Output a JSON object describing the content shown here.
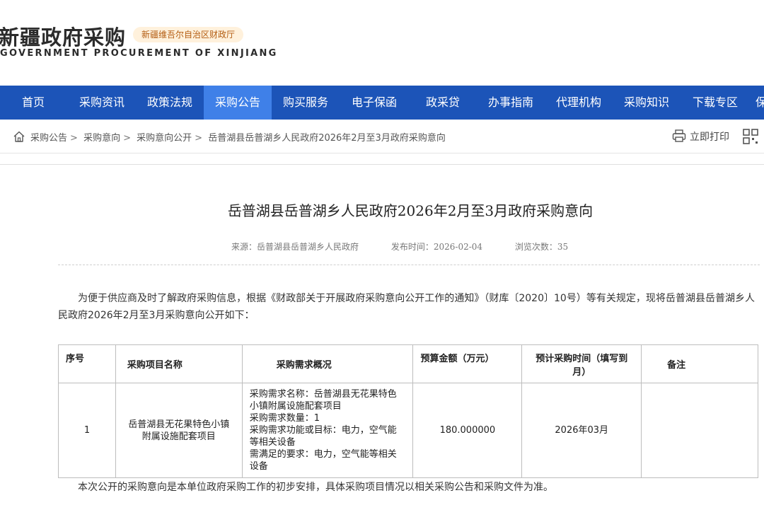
{
  "header": {
    "logo_cn": "新疆政府采购",
    "logo_badge": "新疆维吾尔自治区财政厅",
    "logo_en": "GOVERNMENT PROCUREMENT OF XINJIANG"
  },
  "nav": {
    "items": [
      "首页",
      "采购资讯",
      "政策法规",
      "采购公告",
      "购买服务",
      "电子保函",
      "政采贷",
      "办事指南",
      "代理机构",
      "采购知识",
      "下载专区",
      "保"
    ],
    "active": "采购公告"
  },
  "breadcrumb": {
    "items": [
      "采购公告",
      "采购意向",
      "采购意向公开"
    ],
    "current": "岳普湖县岳普湖乡人民政府2026年2月至3月政府采购意向",
    "separator": ">",
    "print_label": "立即打印"
  },
  "article": {
    "title": "岳普湖县岳普湖乡人民政府2026年2月至3月政府采购意向",
    "source": "来源：岳普湖县岳普湖乡人民政府",
    "publish_time": "发布时间：2026-02-04",
    "views": "浏览次数：35",
    "intro": "为便于供应商及时了解政府采购信息，根据《财政部关于开展政府采购意向公开工作的通知》（财库〔2020〕10号）等有关规定，现将岳普湖县岳普湖乡人民政府2026年2月至3月采购意向公开如下：",
    "table": {
      "headers": [
        "序号",
        "采购项目名称",
        "采购需求概况",
        "预算金额（万元）",
        "预计采购时间（填写到月）",
        "备注"
      ],
      "rows": [
        {
          "index": "1",
          "name": "岳普湖县无花果特色小镇附属设施配套项目",
          "desc": [
            "采购需求名称：岳普湖县无花果特色小镇附属设施配套项目",
            "采购需求数量：1",
            "采购需求功能或目标：电力，空气能等相关设备",
            "需满足的要求：电力，空气能等相关设备"
          ],
          "budget": "180.000000",
          "time": "2026年03月",
          "remark": ""
        }
      ]
    },
    "note": "本次公开的采购意向是本单位政府采购工作的初步安排，具体采购项目情况以相关采购公告和采购文件为准。"
  },
  "colors": {
    "nav_bg": "#1c54b8",
    "nav_active": "#3f80e8",
    "badge_bg": "#fff1dc",
    "badge_text": "#b35d12"
  }
}
